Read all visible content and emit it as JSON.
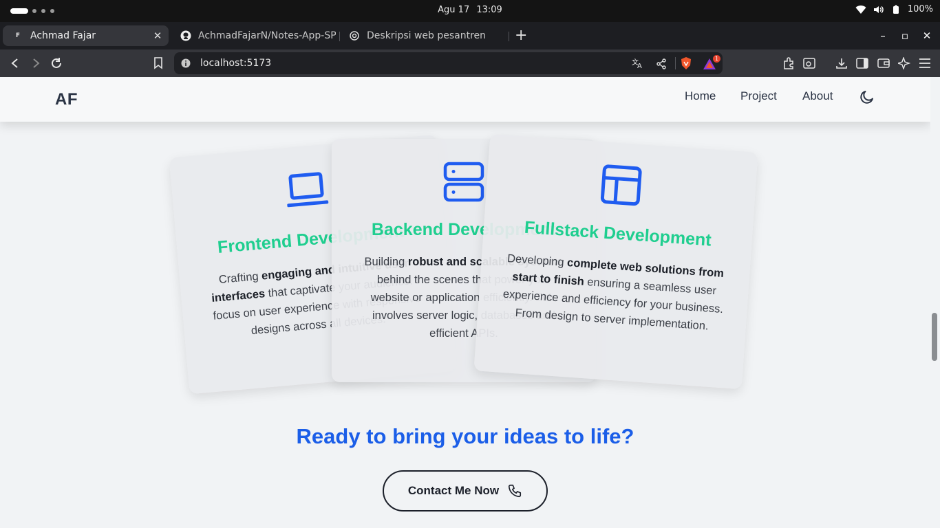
{
  "os": {
    "date": "Agu 17",
    "time": "13:09",
    "battery": "100%"
  },
  "browser": {
    "tabs": [
      {
        "title": "Achmad Fajar",
        "active": true
      },
      {
        "title": "AchmadFajarN/Notes-App-SP",
        "active": false
      },
      {
        "title": "Deskripsi web pesantren",
        "active": false
      }
    ],
    "address": "localhost:5173",
    "brave_badge": "1"
  },
  "site": {
    "logo": "AF",
    "nav": {
      "home": "Home",
      "project": "Project",
      "about": "About"
    },
    "cards": {
      "frontend": {
        "title": "Frontend Development",
        "pre": "Crafting ",
        "bold": "engaging and intuitive user interfaces",
        "post": " that captivate your audience. I focus on user experience with responsive designs across all devices."
      },
      "backend": {
        "title": "Backend Development",
        "pre": "Building ",
        "bold": "robust and scalable systems",
        "post": " behind the scenes that power your website or application efficiently. This involves server logic, databases and efficient APIs."
      },
      "fullstack": {
        "title": "Fullstack Development",
        "pre": "Developing ",
        "bold": "complete web solutions from start to finish",
        "post": " ensuring a seamless user experience and efficiency for your business. From design to server implementation."
      }
    },
    "cta": {
      "title": "Ready to bring your ideas to life?",
      "button": "Contact Me Now"
    },
    "colors": {
      "accent_green": "#1fce8f",
      "accent_blue": "#1b5ee8",
      "icon_blue": "#1f5cf0"
    }
  },
  "icons": [
    "laptop-icon",
    "server-icon",
    "layout-icon",
    "moon-icon",
    "phone-icon",
    "github-icon",
    "chatgpt-icon"
  ]
}
